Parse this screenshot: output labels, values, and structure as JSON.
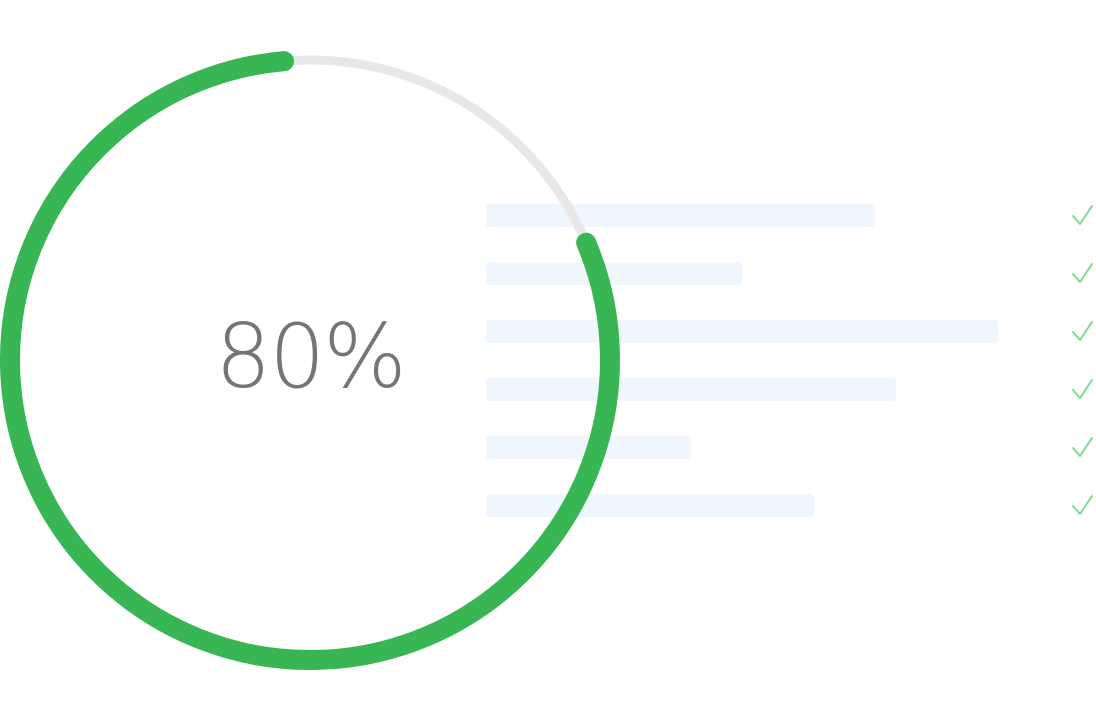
{
  "progress": {
    "label": "80%",
    "value": 0.8
  },
  "colors": {
    "progress": "#38b653",
    "track": "#e8e8eb",
    "placeholder": "#eff6fd",
    "check": "#7ddc93",
    "label": "#757575"
  },
  "checklist": {
    "bar_fill_fractions": [
      0.76,
      0.5,
      1.0,
      0.8,
      0.4,
      0.64
    ],
    "icon": "checkmark-icon"
  }
}
